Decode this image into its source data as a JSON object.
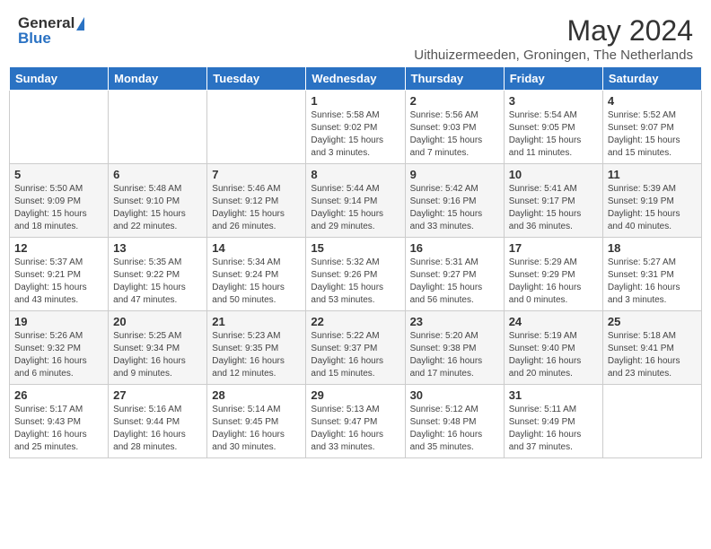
{
  "header": {
    "logo_general": "General",
    "logo_blue": "Blue",
    "month_title": "May 2024",
    "subtitle": "Uithuizermeeden, Groningen, The Netherlands"
  },
  "days_of_week": [
    "Sunday",
    "Monday",
    "Tuesday",
    "Wednesday",
    "Thursday",
    "Friday",
    "Saturday"
  ],
  "weeks": [
    [
      {
        "num": "",
        "info": ""
      },
      {
        "num": "",
        "info": ""
      },
      {
        "num": "",
        "info": ""
      },
      {
        "num": "1",
        "info": "Sunrise: 5:58 AM\nSunset: 9:02 PM\nDaylight: 15 hours and 3 minutes."
      },
      {
        "num": "2",
        "info": "Sunrise: 5:56 AM\nSunset: 9:03 PM\nDaylight: 15 hours and 7 minutes."
      },
      {
        "num": "3",
        "info": "Sunrise: 5:54 AM\nSunset: 9:05 PM\nDaylight: 15 hours and 11 minutes."
      },
      {
        "num": "4",
        "info": "Sunrise: 5:52 AM\nSunset: 9:07 PM\nDaylight: 15 hours and 15 minutes."
      }
    ],
    [
      {
        "num": "5",
        "info": "Sunrise: 5:50 AM\nSunset: 9:09 PM\nDaylight: 15 hours and 18 minutes."
      },
      {
        "num": "6",
        "info": "Sunrise: 5:48 AM\nSunset: 9:10 PM\nDaylight: 15 hours and 22 minutes."
      },
      {
        "num": "7",
        "info": "Sunrise: 5:46 AM\nSunset: 9:12 PM\nDaylight: 15 hours and 26 minutes."
      },
      {
        "num": "8",
        "info": "Sunrise: 5:44 AM\nSunset: 9:14 PM\nDaylight: 15 hours and 29 minutes."
      },
      {
        "num": "9",
        "info": "Sunrise: 5:42 AM\nSunset: 9:16 PM\nDaylight: 15 hours and 33 minutes."
      },
      {
        "num": "10",
        "info": "Sunrise: 5:41 AM\nSunset: 9:17 PM\nDaylight: 15 hours and 36 minutes."
      },
      {
        "num": "11",
        "info": "Sunrise: 5:39 AM\nSunset: 9:19 PM\nDaylight: 15 hours and 40 minutes."
      }
    ],
    [
      {
        "num": "12",
        "info": "Sunrise: 5:37 AM\nSunset: 9:21 PM\nDaylight: 15 hours and 43 minutes."
      },
      {
        "num": "13",
        "info": "Sunrise: 5:35 AM\nSunset: 9:22 PM\nDaylight: 15 hours and 47 minutes."
      },
      {
        "num": "14",
        "info": "Sunrise: 5:34 AM\nSunset: 9:24 PM\nDaylight: 15 hours and 50 minutes."
      },
      {
        "num": "15",
        "info": "Sunrise: 5:32 AM\nSunset: 9:26 PM\nDaylight: 15 hours and 53 minutes."
      },
      {
        "num": "16",
        "info": "Sunrise: 5:31 AM\nSunset: 9:27 PM\nDaylight: 15 hours and 56 minutes."
      },
      {
        "num": "17",
        "info": "Sunrise: 5:29 AM\nSunset: 9:29 PM\nDaylight: 16 hours and 0 minutes."
      },
      {
        "num": "18",
        "info": "Sunrise: 5:27 AM\nSunset: 9:31 PM\nDaylight: 16 hours and 3 minutes."
      }
    ],
    [
      {
        "num": "19",
        "info": "Sunrise: 5:26 AM\nSunset: 9:32 PM\nDaylight: 16 hours and 6 minutes."
      },
      {
        "num": "20",
        "info": "Sunrise: 5:25 AM\nSunset: 9:34 PM\nDaylight: 16 hours and 9 minutes."
      },
      {
        "num": "21",
        "info": "Sunrise: 5:23 AM\nSunset: 9:35 PM\nDaylight: 16 hours and 12 minutes."
      },
      {
        "num": "22",
        "info": "Sunrise: 5:22 AM\nSunset: 9:37 PM\nDaylight: 16 hours and 15 minutes."
      },
      {
        "num": "23",
        "info": "Sunrise: 5:20 AM\nSunset: 9:38 PM\nDaylight: 16 hours and 17 minutes."
      },
      {
        "num": "24",
        "info": "Sunrise: 5:19 AM\nSunset: 9:40 PM\nDaylight: 16 hours and 20 minutes."
      },
      {
        "num": "25",
        "info": "Sunrise: 5:18 AM\nSunset: 9:41 PM\nDaylight: 16 hours and 23 minutes."
      }
    ],
    [
      {
        "num": "26",
        "info": "Sunrise: 5:17 AM\nSunset: 9:43 PM\nDaylight: 16 hours and 25 minutes."
      },
      {
        "num": "27",
        "info": "Sunrise: 5:16 AM\nSunset: 9:44 PM\nDaylight: 16 hours and 28 minutes."
      },
      {
        "num": "28",
        "info": "Sunrise: 5:14 AM\nSunset: 9:45 PM\nDaylight: 16 hours and 30 minutes."
      },
      {
        "num": "29",
        "info": "Sunrise: 5:13 AM\nSunset: 9:47 PM\nDaylight: 16 hours and 33 minutes."
      },
      {
        "num": "30",
        "info": "Sunrise: 5:12 AM\nSunset: 9:48 PM\nDaylight: 16 hours and 35 minutes."
      },
      {
        "num": "31",
        "info": "Sunrise: 5:11 AM\nSunset: 9:49 PM\nDaylight: 16 hours and 37 minutes."
      },
      {
        "num": "",
        "info": ""
      }
    ]
  ]
}
